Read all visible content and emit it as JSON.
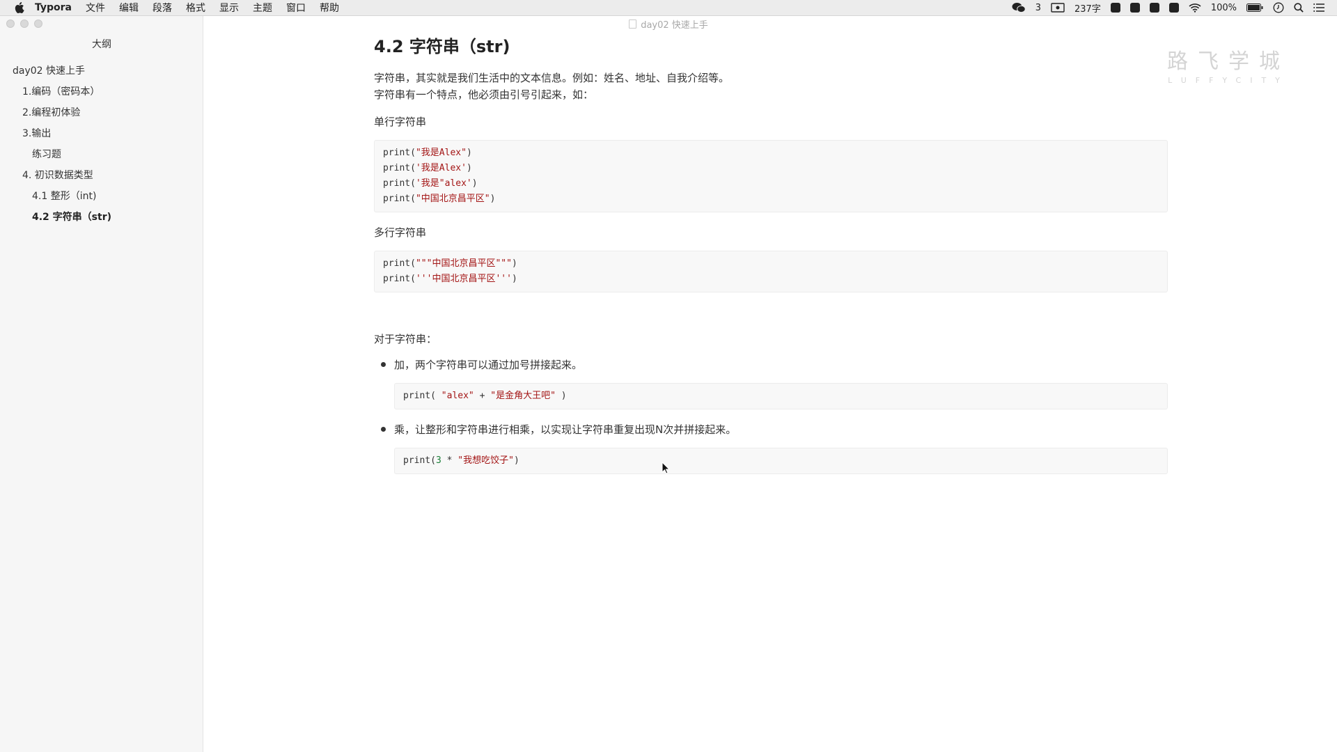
{
  "menubar": {
    "app_name": "Typora",
    "items": [
      "文件",
      "编辑",
      "段落",
      "格式",
      "显示",
      "主题",
      "窗口",
      "帮助"
    ],
    "wechat_count": "3",
    "word_count": "237字",
    "battery": "100%"
  },
  "window": {
    "title": "day02 快速上手"
  },
  "sidebar": {
    "title": "大纲",
    "items": [
      {
        "label": "day02 快速上手"
      },
      {
        "label": "1.编码（密码本）"
      },
      {
        "label": "2.编程初体验"
      },
      {
        "label": "3.输出"
      },
      {
        "label": "练习题"
      },
      {
        "label": "4. 初识数据类型"
      },
      {
        "label": "4.1 整形（int)"
      },
      {
        "label": "4.2 字符串（str)"
      }
    ]
  },
  "watermark": {
    "cn": "路飞学城",
    "en": "LUFFYCITY"
  },
  "content": {
    "heading": "4.2 字符串（str)",
    "intro_1": "字符串，其实就是我们生活中的文本信息。例如：姓名、地址、自我介绍等。",
    "intro_2": "字符串有一个特点，他必须由引号引起来，如：",
    "single_label": "单行字符串",
    "single_code": [
      {
        "fn": "print(",
        "s": "\"我是Alex\"",
        "end": ")"
      },
      {
        "fn": "print(",
        "s": "'我是Alex'",
        "end": ")"
      },
      {
        "fn": "print(",
        "s": "'我是\"alex'",
        "end": ")"
      },
      {
        "fn": "print(",
        "s": "\"中国北京昌平区\"",
        "end": ")"
      }
    ],
    "multi_label": "多行字符串",
    "multi_code": [
      {
        "fn": "print(",
        "s": "\"\"\"中国北京昌平区\"\"\"",
        "end": ")"
      },
      {
        "fn": "print(",
        "s": "'''中国北京昌平区'''",
        "end": ")"
      }
    ],
    "for_strings": "对于字符串：",
    "bullet_add": "加，两个字符串可以通过加号拼接起来。",
    "code_add": {
      "fn": "print( ",
      "s1": "\"alex\"",
      "op": " + ",
      "s2": "\"是金角大王吧\"",
      "end": " )"
    },
    "bullet_mul": "乘，让整形和字符串进行相乘，以实现让字符串重复出现N次并拼接起来。",
    "code_mul": {
      "fn": "print(",
      "n": "3",
      "op": " * ",
      "s": "\"我想吃饺子\"",
      "end": ")"
    }
  }
}
